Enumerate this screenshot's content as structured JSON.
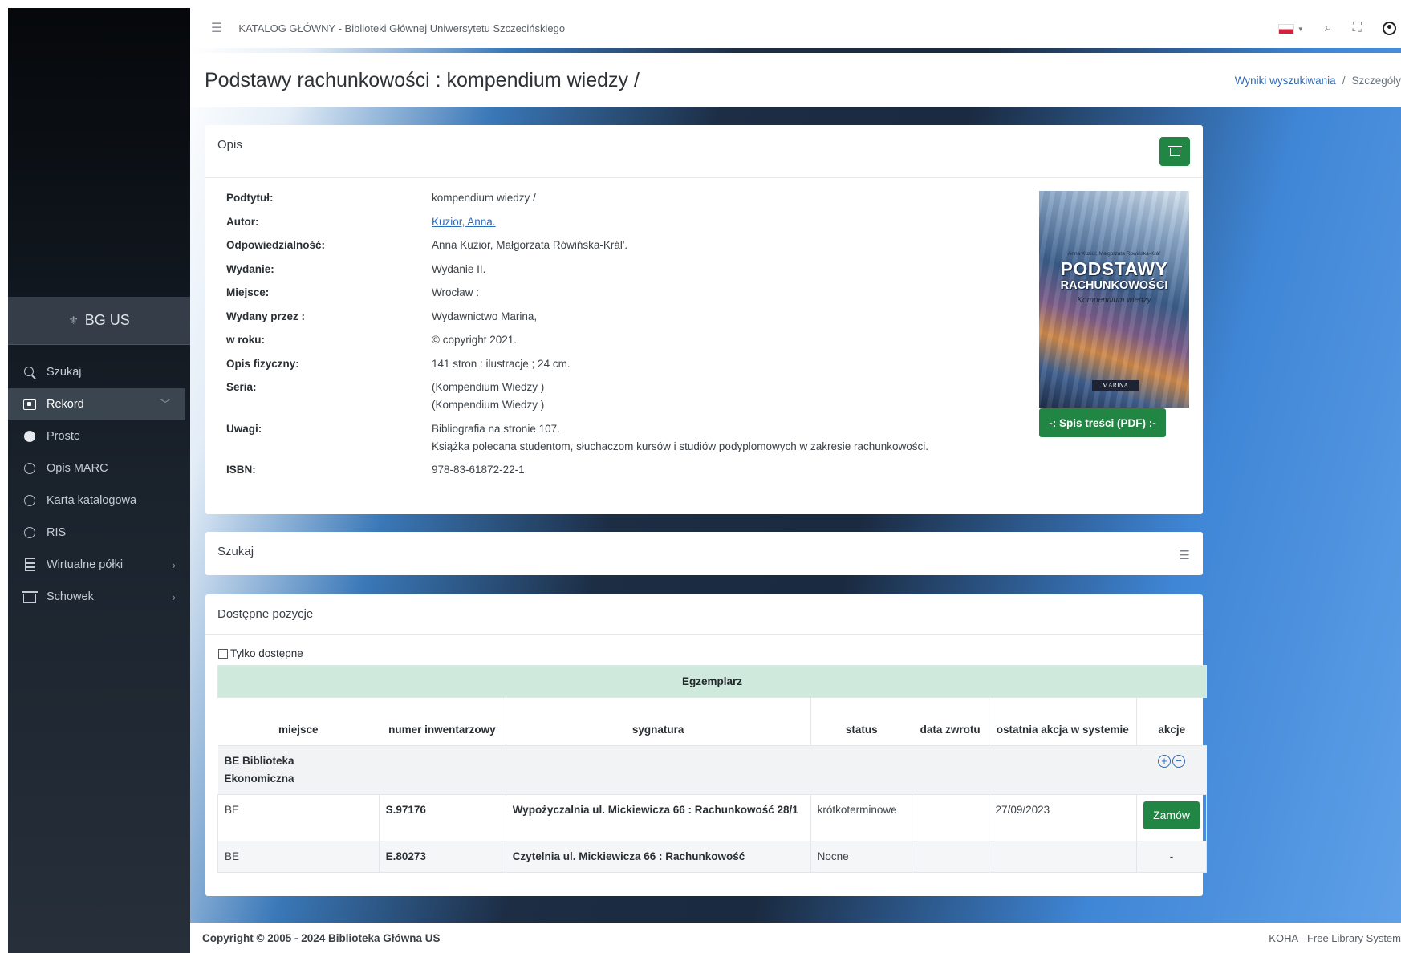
{
  "topbar": {
    "title": "KATALOG GŁÓWNY - Biblioteki Głównej Uniwersytetu Szczecińskiego"
  },
  "sidebar": {
    "brand": "BG US",
    "items": [
      {
        "label": "Szukaj",
        "icon": "search-icon"
      },
      {
        "label": "Rekord",
        "icon": "record-icon",
        "active": true
      },
      {
        "label": "Proste",
        "icon": "dot-filled-icon"
      },
      {
        "label": "Opis MARC",
        "icon": "circle-icon"
      },
      {
        "label": "Karta katalogowa",
        "icon": "circle-icon"
      },
      {
        "label": "RIS",
        "icon": "circle-icon"
      },
      {
        "label": "Wirtualne półki",
        "icon": "shelf-icon"
      },
      {
        "label": "Schowek",
        "icon": "basket-icon"
      }
    ]
  },
  "page": {
    "title": "Podstawy rachunkowości : kompendium wiedzy /",
    "breadcrumb": {
      "link": "Wyniki wyszukiwania",
      "separator": "/",
      "current": "Szczegóły"
    }
  },
  "opis": {
    "heading": "Opis",
    "fields": [
      {
        "label": "Podtytuł:",
        "value": "kompendium wiedzy /"
      },
      {
        "label": "Autor:",
        "value": "Kuzior, Anna."
      },
      {
        "label": "Odpowiedzialność:",
        "value": "Anna Kuzior, Małgorzata Rówińska-Král'."
      },
      {
        "label": "Wydanie:",
        "value": "Wydanie II."
      },
      {
        "label": "Miejsce:",
        "value": "Wrocław :"
      },
      {
        "label": "Wydany przez :",
        "value": "Wydawnictwo Marina,"
      },
      {
        "label": "w roku:",
        "value": "© copyright 2021."
      },
      {
        "label": "Opis fizyczny:",
        "value": "141 stron : ilustracje ; 24 cm."
      },
      {
        "label": "Seria:",
        "value": "(Kompendium Wiedzy )",
        "value2": "(Kompendium Wiedzy )"
      },
      {
        "label": "Uwagi:",
        "value": "Bibliografia na stronie 107.",
        "value2": "Książka polecana studentom, słuchaczom kursów i studiów podyplomowych w zakresie rachunkowości."
      },
      {
        "label": "ISBN:",
        "value": "978-83-61872-22-1"
      }
    ],
    "cover": {
      "authors": "Anna Kuzior, Małgorzata Rowińska-Kráľ",
      "title_line1": "PODSTAWY",
      "title_line2": "RACHUNKOWOŚCI",
      "subtitle": "Kompendium wiedzy",
      "publisher": "MARINA"
    },
    "toc_button": "-: Spis treści (PDF) :-"
  },
  "search_card": {
    "heading": "Szukaj"
  },
  "items_card": {
    "heading": "Dostępne pozycje",
    "only_available": "Tylko dostępne",
    "group_header": "Egzemplarz",
    "columns": {
      "place": "miejsce",
      "inventory": "numer inwentarzowy",
      "call_number": "sygnatura",
      "status": "status",
      "due": "data zwrotu",
      "last_action": "ostatnia akcja w systemie",
      "actions": "akcje"
    },
    "library": "BE Biblioteka Ekonomiczna",
    "rows": [
      {
        "place": "BE",
        "inventory": "S.97176",
        "call_number": "Wypożyczalnia ul. Mickiewicza 66 : Rachunkowość 28/1",
        "status": "krótkoterminowe",
        "due": "",
        "last_action": "27/09/2023",
        "action": "Zamów"
      },
      {
        "place": "BE",
        "inventory": "E.80273",
        "call_number": "Czytelnia ul. Mickiewicza 66 : Rachunkowość",
        "status": "Nocne",
        "due": "",
        "last_action": "",
        "action": "-"
      }
    ]
  },
  "footer": {
    "copyright": "Copyright © 2005 - 2024 Biblioteka Główna US",
    "koha": "KOHA - Free Library System"
  }
}
